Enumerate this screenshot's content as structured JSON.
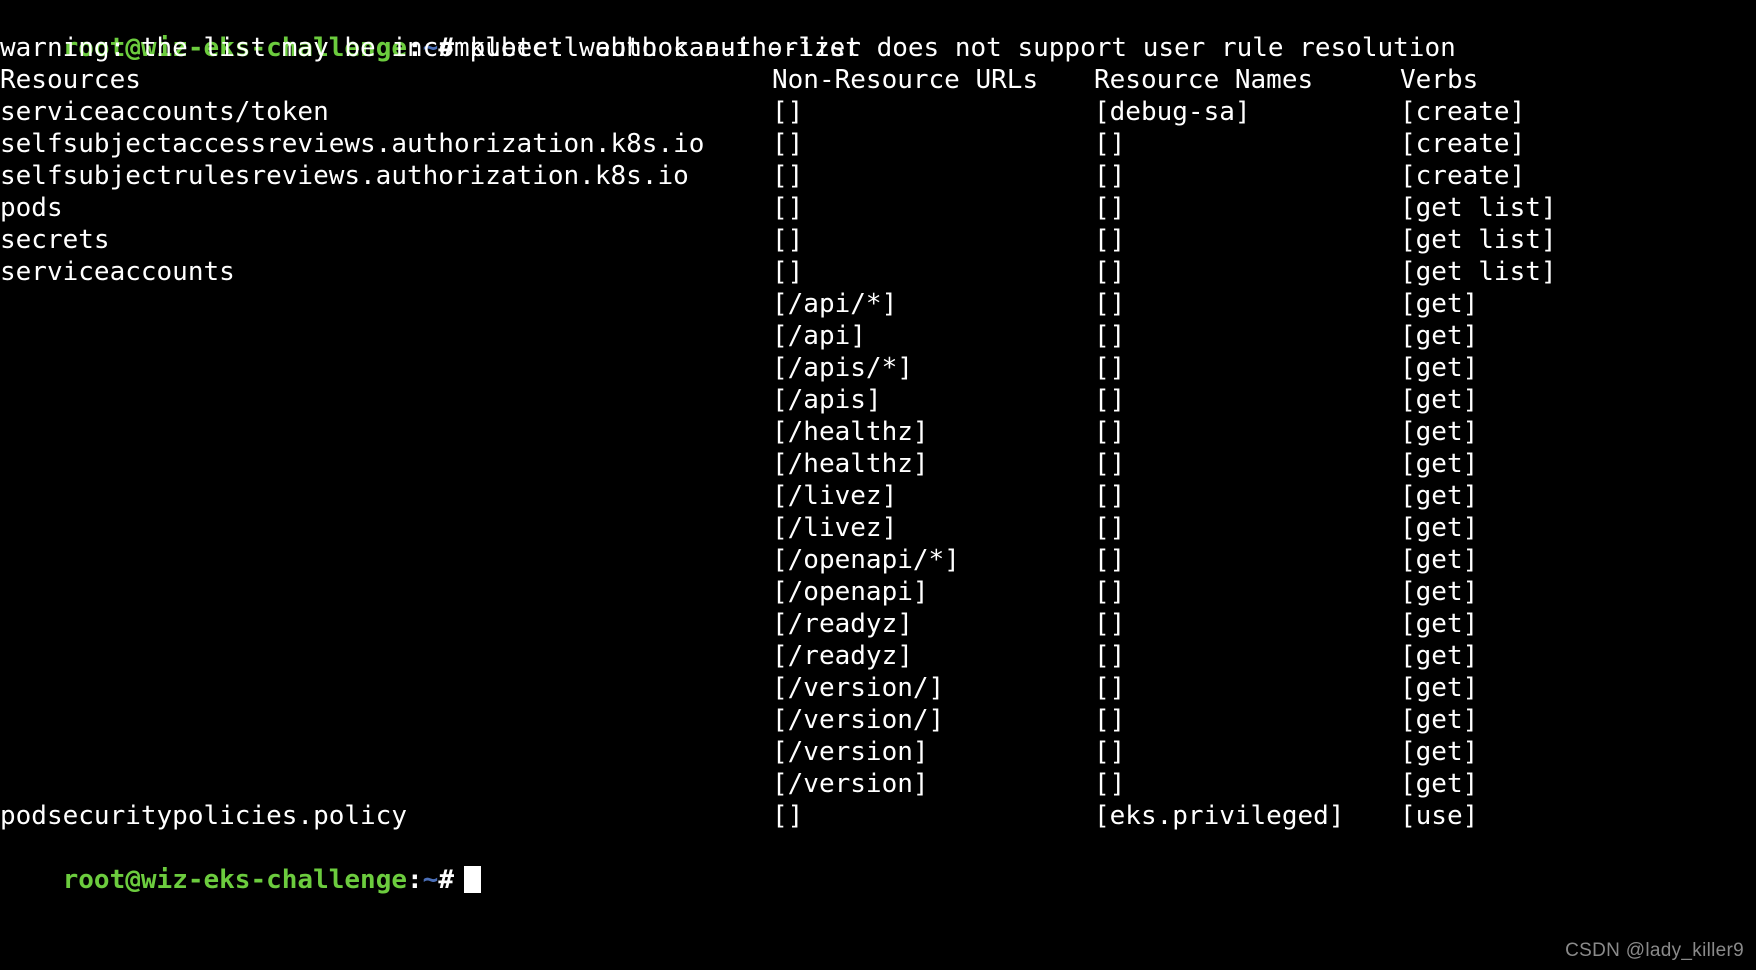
{
  "terminal": {
    "background_color": "#000000",
    "foreground_color": "#ffffff",
    "prompt_color": "#6ccc3e",
    "tilde_color": "#4b6fb8",
    "prompt": {
      "user_host": "root@wiz-eks-challenge",
      "colon": ":",
      "path": "~",
      "sigil": "#"
    },
    "command": "kubectl auth can-i --list",
    "warning": "warning: the list may be incomplete: webhook authorizer does not support user rule resolution",
    "headers": {
      "resources": "Resources",
      "non_resource_urls": "Non-Resource URLs",
      "resource_names": "Resource Names",
      "verbs": "Verbs"
    },
    "rows": [
      {
        "resource": "serviceaccounts/token",
        "url": "[]",
        "name": "[debug-sa]",
        "verb": "[create]"
      },
      {
        "resource": "selfsubjectaccessreviews.authorization.k8s.io",
        "url": "[]",
        "name": "[]",
        "verb": "[create]"
      },
      {
        "resource": "selfsubjectrulesreviews.authorization.k8s.io",
        "url": "[]",
        "name": "[]",
        "verb": "[create]"
      },
      {
        "resource": "pods",
        "url": "[]",
        "name": "[]",
        "verb": "[get list]"
      },
      {
        "resource": "secrets",
        "url": "[]",
        "name": "[]",
        "verb": "[get list]"
      },
      {
        "resource": "serviceaccounts",
        "url": "[]",
        "name": "[]",
        "verb": "[get list]"
      },
      {
        "resource": "",
        "url": "[/api/*]",
        "name": "[]",
        "verb": "[get]"
      },
      {
        "resource": "",
        "url": "[/api]",
        "name": "[]",
        "verb": "[get]"
      },
      {
        "resource": "",
        "url": "[/apis/*]",
        "name": "[]",
        "verb": "[get]"
      },
      {
        "resource": "",
        "url": "[/apis]",
        "name": "[]",
        "verb": "[get]"
      },
      {
        "resource": "",
        "url": "[/healthz]",
        "name": "[]",
        "verb": "[get]"
      },
      {
        "resource": "",
        "url": "[/healthz]",
        "name": "[]",
        "verb": "[get]"
      },
      {
        "resource": "",
        "url": "[/livez]",
        "name": "[]",
        "verb": "[get]"
      },
      {
        "resource": "",
        "url": "[/livez]",
        "name": "[]",
        "verb": "[get]"
      },
      {
        "resource": "",
        "url": "[/openapi/*]",
        "name": "[]",
        "verb": "[get]"
      },
      {
        "resource": "",
        "url": "[/openapi]",
        "name": "[]",
        "verb": "[get]"
      },
      {
        "resource": "",
        "url": "[/readyz]",
        "name": "[]",
        "verb": "[get]"
      },
      {
        "resource": "",
        "url": "[/readyz]",
        "name": "[]",
        "verb": "[get]"
      },
      {
        "resource": "",
        "url": "[/version/]",
        "name": "[]",
        "verb": "[get]"
      },
      {
        "resource": "",
        "url": "[/version/]",
        "name": "[]",
        "verb": "[get]"
      },
      {
        "resource": "",
        "url": "[/version]",
        "name": "[]",
        "verb": "[get]"
      },
      {
        "resource": "",
        "url": "[/version]",
        "name": "[]",
        "verb": "[get]"
      },
      {
        "resource": "podsecuritypolicies.policy",
        "url": "[]",
        "name": "[eks.privileged]",
        "verb": "[use]"
      }
    ],
    "watermark": "CSDN @lady_killer9"
  }
}
